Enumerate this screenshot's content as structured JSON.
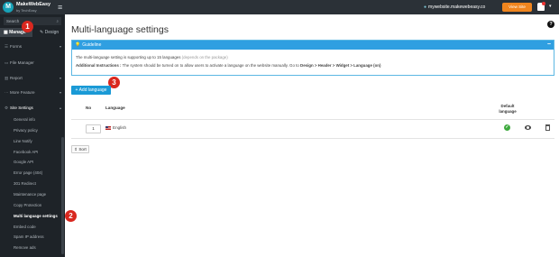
{
  "topbar": {
    "brand": "MakeWebEasy",
    "brand_sub": "by TechEasy",
    "site_url": "mywebsite.makewebeasy.co",
    "view_site_label": "View Site"
  },
  "sidebar": {
    "search_placeholder": "Search",
    "tab_manage": "Manage",
    "tab_design": "Design",
    "items": [
      {
        "label": "Forms"
      },
      {
        "label": "File Manager"
      },
      {
        "label": "Report"
      },
      {
        "label": "More Feature"
      },
      {
        "label": "Site Settings"
      }
    ],
    "sub_items": [
      {
        "label": "General info"
      },
      {
        "label": "Privacy policy"
      },
      {
        "label": "Line Notify"
      },
      {
        "label": "Facebook API"
      },
      {
        "label": "Google API"
      },
      {
        "label": "Error page (404)"
      },
      {
        "label": "301 Redirect"
      },
      {
        "label": "Maintenance page"
      },
      {
        "label": "Copy Protection"
      },
      {
        "label": "Multi language settings"
      },
      {
        "label": "Embed code"
      },
      {
        "label": "Spam IP address"
      },
      {
        "label": "Remove ads"
      }
    ]
  },
  "badges": [
    "1",
    "2",
    "3"
  ],
  "main": {
    "title": "Multi-language settings",
    "guideline": {
      "title": "Guideline",
      "line1": "The multi-language setting is supporting up to 15 languages",
      "line1_muted": "(depends on the package)",
      "line2_label": "Additional Instructions :",
      "line2_text": "The system should be turned on to allow users to activate a language on the website manually. Go to",
      "line2_path": "Design > Header > Widget > Language (on)"
    },
    "add_language_label": "+ Add language",
    "table": {
      "col_no": "No",
      "col_language": "Language",
      "col_default": "Default language",
      "rows": [
        {
          "no": "1",
          "language": "English"
        }
      ]
    },
    "sort_label": "Sort"
  },
  "colors": {
    "topbar": "#2b3137",
    "sidebar": "#1e2328",
    "accent": "#1a9ad6",
    "view_site": "#f0851e",
    "badge": "#d9281f"
  }
}
